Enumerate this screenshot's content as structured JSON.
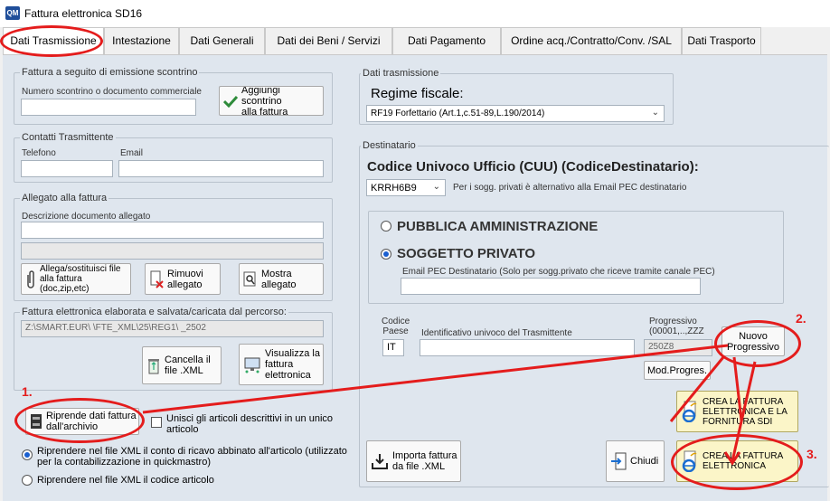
{
  "window": {
    "title": "Fattura elettronica SD16",
    "icon": "QM"
  },
  "tabs": [
    "Dati Trasmissione",
    "Intestazione",
    "Dati Generali",
    "Dati dei Beni / Servizi",
    "Dati Pagamento",
    "Ordine acq./Contratto/Conv. /SAL",
    "Dati Trasporto"
  ],
  "scontrino": {
    "group_title": "Fattura a seguito di emissione scontrino",
    "number_label": "Numero scontrino o documento commerciale",
    "number_value": "",
    "add_button": "Aggiungi scontrino\nalla fattura"
  },
  "contatti": {
    "group_title": "Contatti Trasmittente",
    "phone_label": "Telefono",
    "phone_value": "",
    "email_label": "Email",
    "email_value": ""
  },
  "allegato": {
    "group_title": "Allegato alla fattura",
    "desc_label": "Descrizione documento allegato",
    "desc_value": "",
    "path_value": "",
    "attach_button": "Allega/sostituisci file\nalla fattura\n(doc,zip,etc)",
    "remove_button": "Rimuovi\nallegato",
    "show_button": "Mostra\nallegato"
  },
  "xml": {
    "group_title": "Fattura elettronica elaborata e salvata/caricata dal percorso:",
    "path_value": "Z:\\SMART.EUR\\                 \\FTE_XML\\25\\REG1\\                 _2502",
    "delete_button": "Cancella il\nfile .XML",
    "view_button": "Visualizza la\nfattura\nelettronica"
  },
  "riprende": {
    "button": "Riprende dati fattura\ndall'archivio",
    "merge_label": "Unisci gli articoli descrittivi in un unico\narticolo",
    "radio1_label": "Riprendere nel file XML il  conto di ricavo abbinato all'articolo (utilizzato\nper la contabilizzazione in quickmastro)",
    "radio2_label": "Riprendere nel file XML il codice articolo"
  },
  "trasmissione": {
    "group_title": "Dati trasmissione",
    "regime_label": "Regime fiscale:",
    "regime_value": "RF19 Forfettario (Art.1,c.51-89,L.190/2014)"
  },
  "destinatario": {
    "group_title": "Destinatario",
    "cuu_label": "Codice Univoco Ufficio (CUU) (CodiceDestinatario):",
    "cuu_value": "KRRH6B9",
    "cuu_note": "Per i sogg. privati è alternativo alla Email PEC destinatario",
    "pa_label": "PUBBLICA AMMINISTRAZIONE",
    "privato_label": "SOGGETTO PRIVATO",
    "pec_label": "Email PEC Destinatario (Solo per sogg.privato che riceve tramite canale PEC)",
    "pec_value": "",
    "paese_label": "Codice\nPaese",
    "paese_value": "IT",
    "id_label": "Identificativo univoco del Trasmittente",
    "id_value": "",
    "prog_label": "Progressivo\n(00001,..,ZZZ",
    "prog_value": "250Z8",
    "new_prog_button": "Nuovo\nProgressivo",
    "mod_prog_button": "Mod.Progres."
  },
  "actions": {
    "crea_sdi": "CREA LA FATTURA\nELETTRONICA E LA\nFORNITURA SDI",
    "crea": "CREA LA FATTURA\nELETTRONICA",
    "importa": "Importa fattura\nda file .XML",
    "chiudi": "Chiudi"
  },
  "annotations": [
    "1.",
    "2.",
    "3."
  ],
  "colors": {
    "accent": "#1a5fd0",
    "annotation_red": "#e41c1c",
    "panel_bg": "#dfe6ee"
  }
}
